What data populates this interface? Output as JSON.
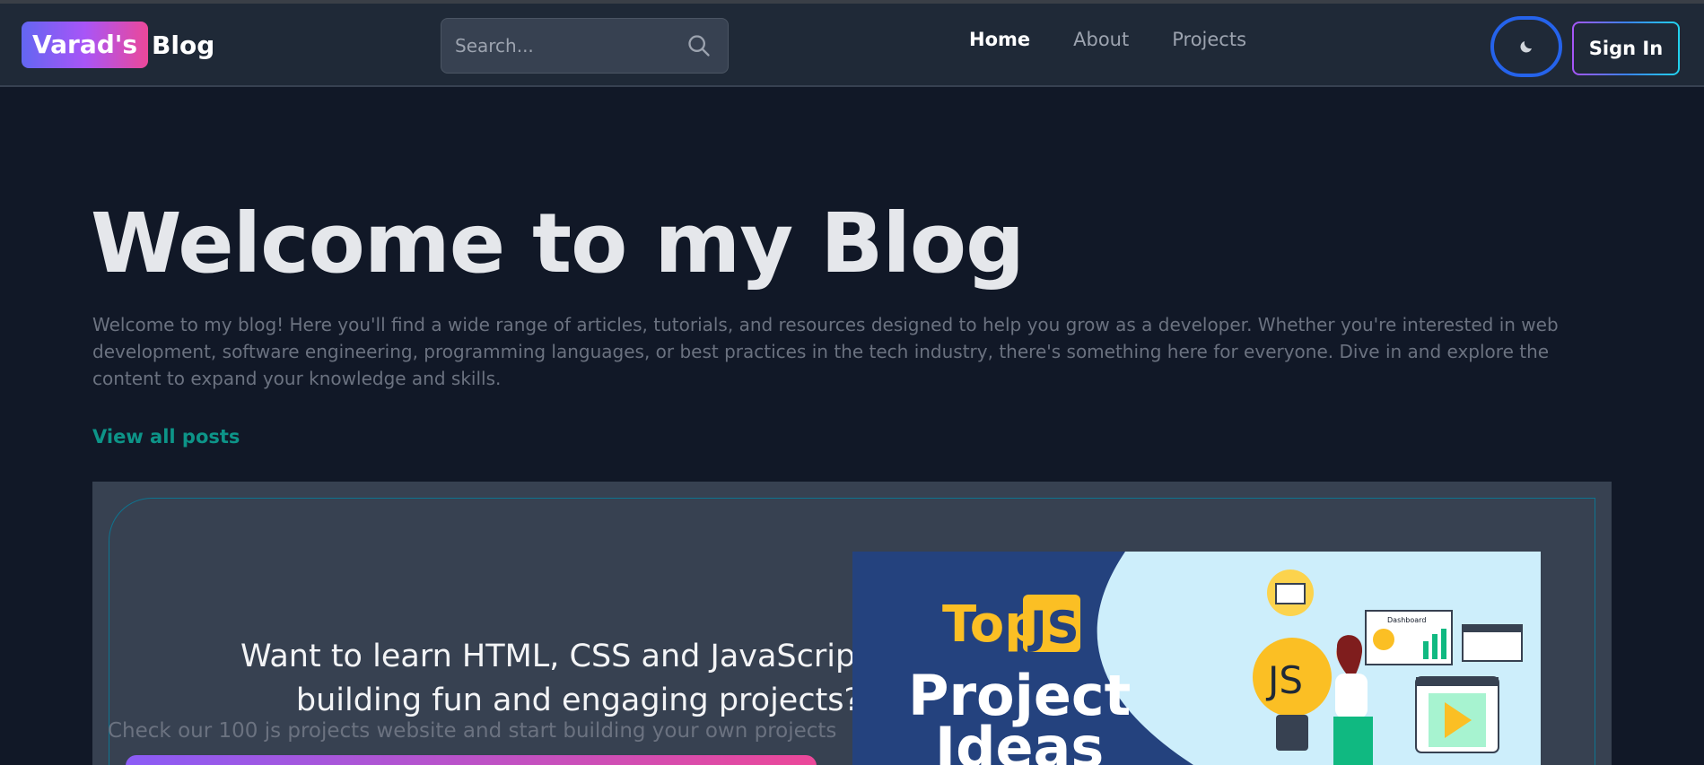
{
  "header": {
    "logo_badge": "Varad's",
    "logo_text": "Blog",
    "search_placeholder": "Search...",
    "nav": [
      {
        "label": "Home",
        "active": true
      },
      {
        "label": "About",
        "active": false
      },
      {
        "label": "Projects",
        "active": false
      }
    ],
    "theme_toggle_icon": "moon-icon",
    "signin_label": "Sign In"
  },
  "hero": {
    "title": "Welcome to my Blog",
    "intro": "Welcome to my blog! Here you'll find a wide range of articles, tutorials, and resources designed to help you grow as a developer. Whether you're interested in web development, software engineering, programming languages, or best practices in the tech industry, there's something here for everyone. Dive in and explore the content to expand your knowledge and skills.",
    "view_all": "View all posts"
  },
  "cta": {
    "title": "Want to learn HTML, CSS and JavaScript by building fun and engaging projects?",
    "subtitle": "Check our 100 js projects website and start building your own projects",
    "promo": {
      "top": "Top",
      "js": "JS",
      "line1": "Project",
      "line2": "Ideas",
      "bulb_text": "JS",
      "dashboard_label": "Dashboard"
    }
  },
  "colors": {
    "background": "#111827",
    "header": "#1f2937",
    "accent_teal": "#0d9488",
    "gradient_start": "#6366f1",
    "gradient_end": "#ec4899"
  }
}
